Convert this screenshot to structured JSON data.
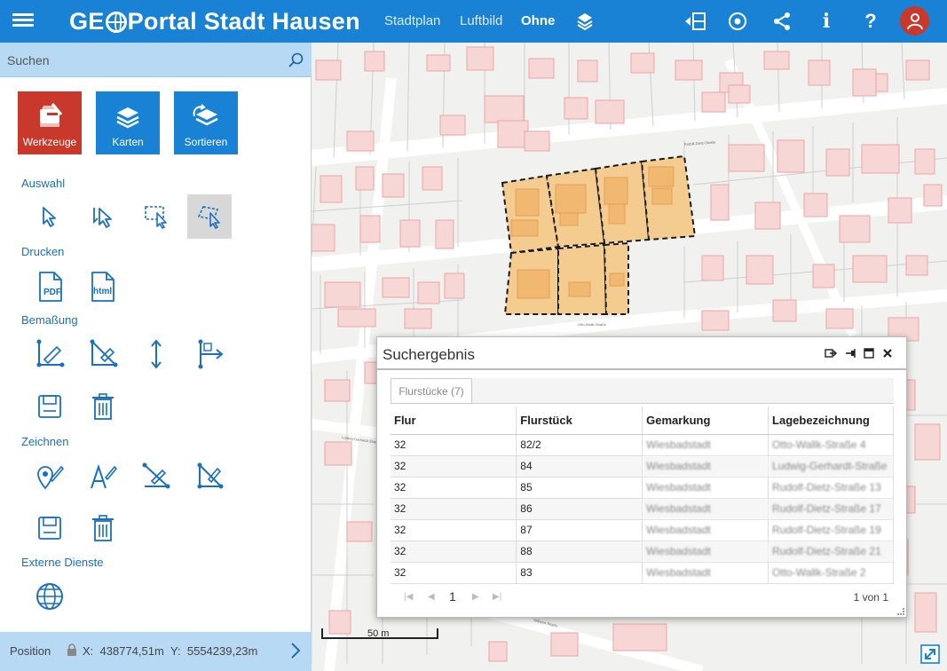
{
  "header": {
    "logo_prefix": "GE",
    "logo_suffix": "Portal Stadt Hausen",
    "map_tabs": [
      "Stadtplan",
      "Luftbild",
      "Ohne"
    ],
    "active_tab": "Ohne"
  },
  "sidebar": {
    "search_placeholder": "Suchen",
    "big_buttons": [
      "Werkzeuge",
      "Karten",
      "Sortieren"
    ],
    "sections": {
      "auswahl": "Auswahl",
      "drucken": "Drucken",
      "bemassung": "Bemaßung",
      "zeichnen": "Zeichnen",
      "externe": "Externe Dienste"
    },
    "print_labels": {
      "pdf": "PDF",
      "html": "html"
    }
  },
  "status": {
    "label": "Position",
    "x_label": "X:",
    "x_value": "438774,51m",
    "y_label": "Y:",
    "y_value": "5554239,23m"
  },
  "map": {
    "scale_label": "50 m",
    "parcel_fill": "#f3c98a",
    "building_fill": "#f7d6d6"
  },
  "dialog": {
    "title": "Suchergebnis",
    "tab_label": "Flurstücke (7)",
    "columns": [
      "Flur",
      "Flurstück",
      "Gemarkung",
      "Lagebezeichnung"
    ],
    "rows": [
      {
        "flur": "32",
        "flurstueck": "82/2",
        "gemarkung": "Wiesbadstadt",
        "lage": "Otto-Wallk-Straße 4"
      },
      {
        "flur": "32",
        "flurstueck": "84",
        "gemarkung": "Wiesbadstadt",
        "lage": "Ludwig-Gerhardt-Straße"
      },
      {
        "flur": "32",
        "flurstueck": "85",
        "gemarkung": "Wiesbadstadt",
        "lage": "Rudolf-Dietz-Straße 13"
      },
      {
        "flur": "32",
        "flurstueck": "86",
        "gemarkung": "Wiesbadstadt",
        "lage": "Rudolf-Dietz-Straße 17"
      },
      {
        "flur": "32",
        "flurstueck": "87",
        "gemarkung": "Wiesbadstadt",
        "lage": "Rudolf-Dietz-Straße 19"
      },
      {
        "flur": "32",
        "flurstueck": "88",
        "gemarkung": "Wiesbadstadt",
        "lage": "Rudolf-Dietz-Straße 21"
      },
      {
        "flur": "32",
        "flurstueck": "83",
        "gemarkung": "Wiesbadstadt",
        "lage": "Otto-Wallk-Straße 2"
      }
    ],
    "current_page": "1",
    "page_count": "1 von 1"
  }
}
